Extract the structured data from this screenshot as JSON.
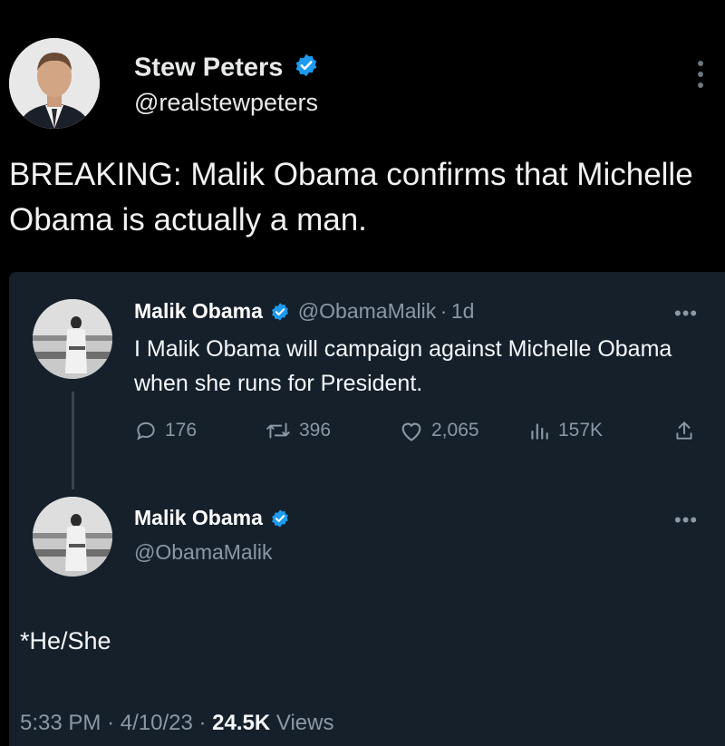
{
  "outer_tweet": {
    "display_name": "Stew Peters",
    "handle": "@realstewpeters",
    "text": "BREAKING: Malik Obama confirms that Michelle Obama is actually a man."
  },
  "reply_tweet": {
    "display_name": "Malik Obama",
    "handle": "@ObamaMalik",
    "separator": "·",
    "time_ago": "1d",
    "text": "I Malik Obama will campaign against Michelle Obama when she runs for President.",
    "metrics": {
      "replies": "176",
      "retweets": "396",
      "likes": "2,065",
      "views": "157K"
    }
  },
  "main_tweet": {
    "display_name": "Malik Obama",
    "handle": "@ObamaMalik",
    "text": "*He/She",
    "time": "5:33 PM",
    "date": "4/10/23",
    "views_count": "24.5K",
    "views_label": "Views",
    "separator": "·"
  },
  "icons": {
    "verified": "verified-badge-icon",
    "more": "more-dots-icon",
    "reply": "reply-icon",
    "retweet": "retweet-icon",
    "like": "heart-icon",
    "views": "views-bar-icon",
    "share": "share-icon"
  },
  "colors": {
    "verified_blue": "#1d9bf0",
    "card_bg": "#15202b",
    "muted_text": "#8b98a5"
  }
}
